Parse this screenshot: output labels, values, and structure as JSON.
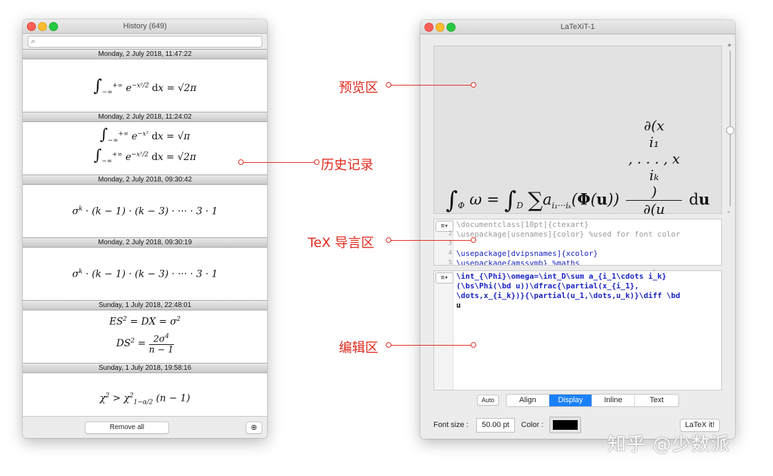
{
  "history_window": {
    "title": "History (649)",
    "search_placeholder": "",
    "entries": [
      {
        "date": "Monday, 2 July 2018, 11:47:22",
        "formula": "∫−∞+∞ e^(−x²/2) dx = √2π"
      },
      {
        "date": "Monday, 2 July 2018, 11:24:02",
        "formula": "∫−∞+∞ e^(−x²) dx = √π ; ∫−∞+∞ e^(−x²/2) dx = √2π"
      },
      {
        "date": "Monday, 2 July 2018, 09:30:42",
        "formula": "σ^k · (k−1) · (k−3) · ··· · 3 · 1"
      },
      {
        "date": "Monday, 2 July 2018, 09:30:19",
        "formula": "σ^k · (k−1) · (k−3) · ··· · 3 · 1"
      },
      {
        "date": "Sunday, 1 July 2018, 22:48:01",
        "formula": "ES² = DX = σ² ; DS² = 2σ⁴ / (n−1)"
      },
      {
        "date": "Sunday, 1 July 2018, 19:58:16",
        "formula": "χ² > χ²₁₋α/2 (n−1)"
      }
    ],
    "remove_all_label": "Remove all"
  },
  "latexit_window": {
    "title": "LaTeXiT-1",
    "preamble_lines": [
      {
        "n": "",
        "text": "\\documentclass[10pt]{ctexart}"
      },
      {
        "n": "2",
        "text": "\\usepackage[usenames]{color} %used for font color"
      },
      {
        "n": "3",
        "text": ""
      },
      {
        "n": "4",
        "text": "\\usepackage[dvipsnames]{xcolor}"
      },
      {
        "n": "5",
        "text": "\\usepackage{amssymb} %maths"
      }
    ],
    "editor_lines": [
      "  \\int_{\\Phi}\\omega=\\int_D\\sum a_{i_1\\cdots i_k}",
      "(\\bs\\Phi(\\bd u))\\dfrac{\\partial(x_{i_1},",
      "\\dots,x_{i_k})}{\\partial(u_1,\\dots,u_k)}\\diff \\bd",
      "u"
    ],
    "auto_label": "Auto",
    "modes": [
      "Align",
      "Display",
      "Inline",
      "Text"
    ],
    "selected_mode": "Display",
    "font_size_label": "Font size :",
    "font_size_value": "50.00 pt",
    "color_label": "Color :",
    "color_value": "#000000",
    "latex_button": "LaTeX it!",
    "zoom_plus": "+",
    "zoom_minus": "-"
  },
  "annotations": {
    "preview": "预览区",
    "history": "历史记录",
    "preamble": "TeX 导言区",
    "editor": "编辑区"
  },
  "watermark": "知乎 @少数派",
  "colors": {
    "annotation": "#e02a1e",
    "selected_segment": "#1a80f8",
    "preview_bg": "#e2e2e2"
  }
}
